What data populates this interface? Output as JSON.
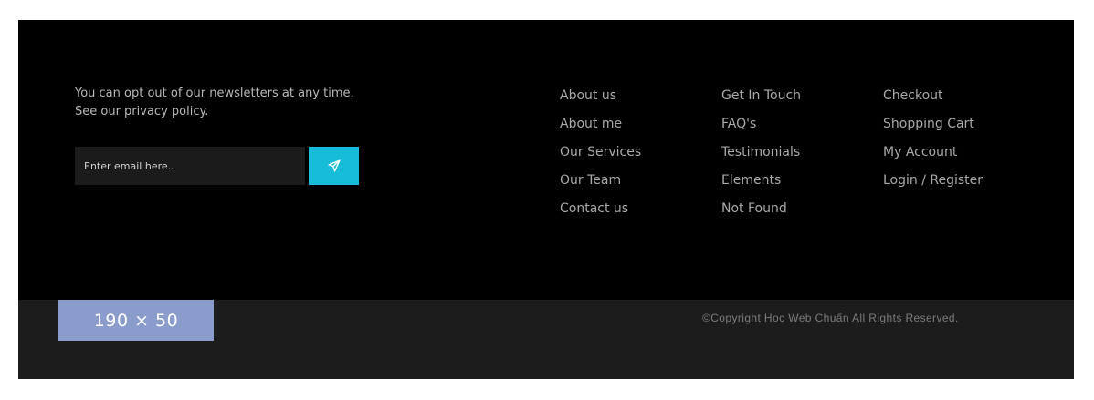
{
  "newsletter": {
    "line1": "You can opt out of our newsletters at any time.",
    "line2": "See our privacy policy.",
    "email_placeholder": "Enter email here..",
    "send_icon": "paper-plane-icon"
  },
  "links": {
    "col1": [
      "About us",
      "About me",
      "Our Services",
      "Our Team",
      "Contact us"
    ],
    "col2": [
      "Get In Touch",
      "FAQ's",
      "Testimonials",
      "Elements",
      "Not Found"
    ],
    "col3": [
      "Checkout",
      "Shopping Cart",
      "My Account",
      "Login / Register"
    ]
  },
  "bottom": {
    "logo_text": "190 × 50",
    "copyright": "©Copyright Hoc Web Chuẩn All Rights Reserved."
  },
  "colors": {
    "accent": "#16bcd8",
    "top_bg": "#000000",
    "bottom_bg": "#1c1c1c",
    "logo_bg": "#8a9ccc"
  }
}
